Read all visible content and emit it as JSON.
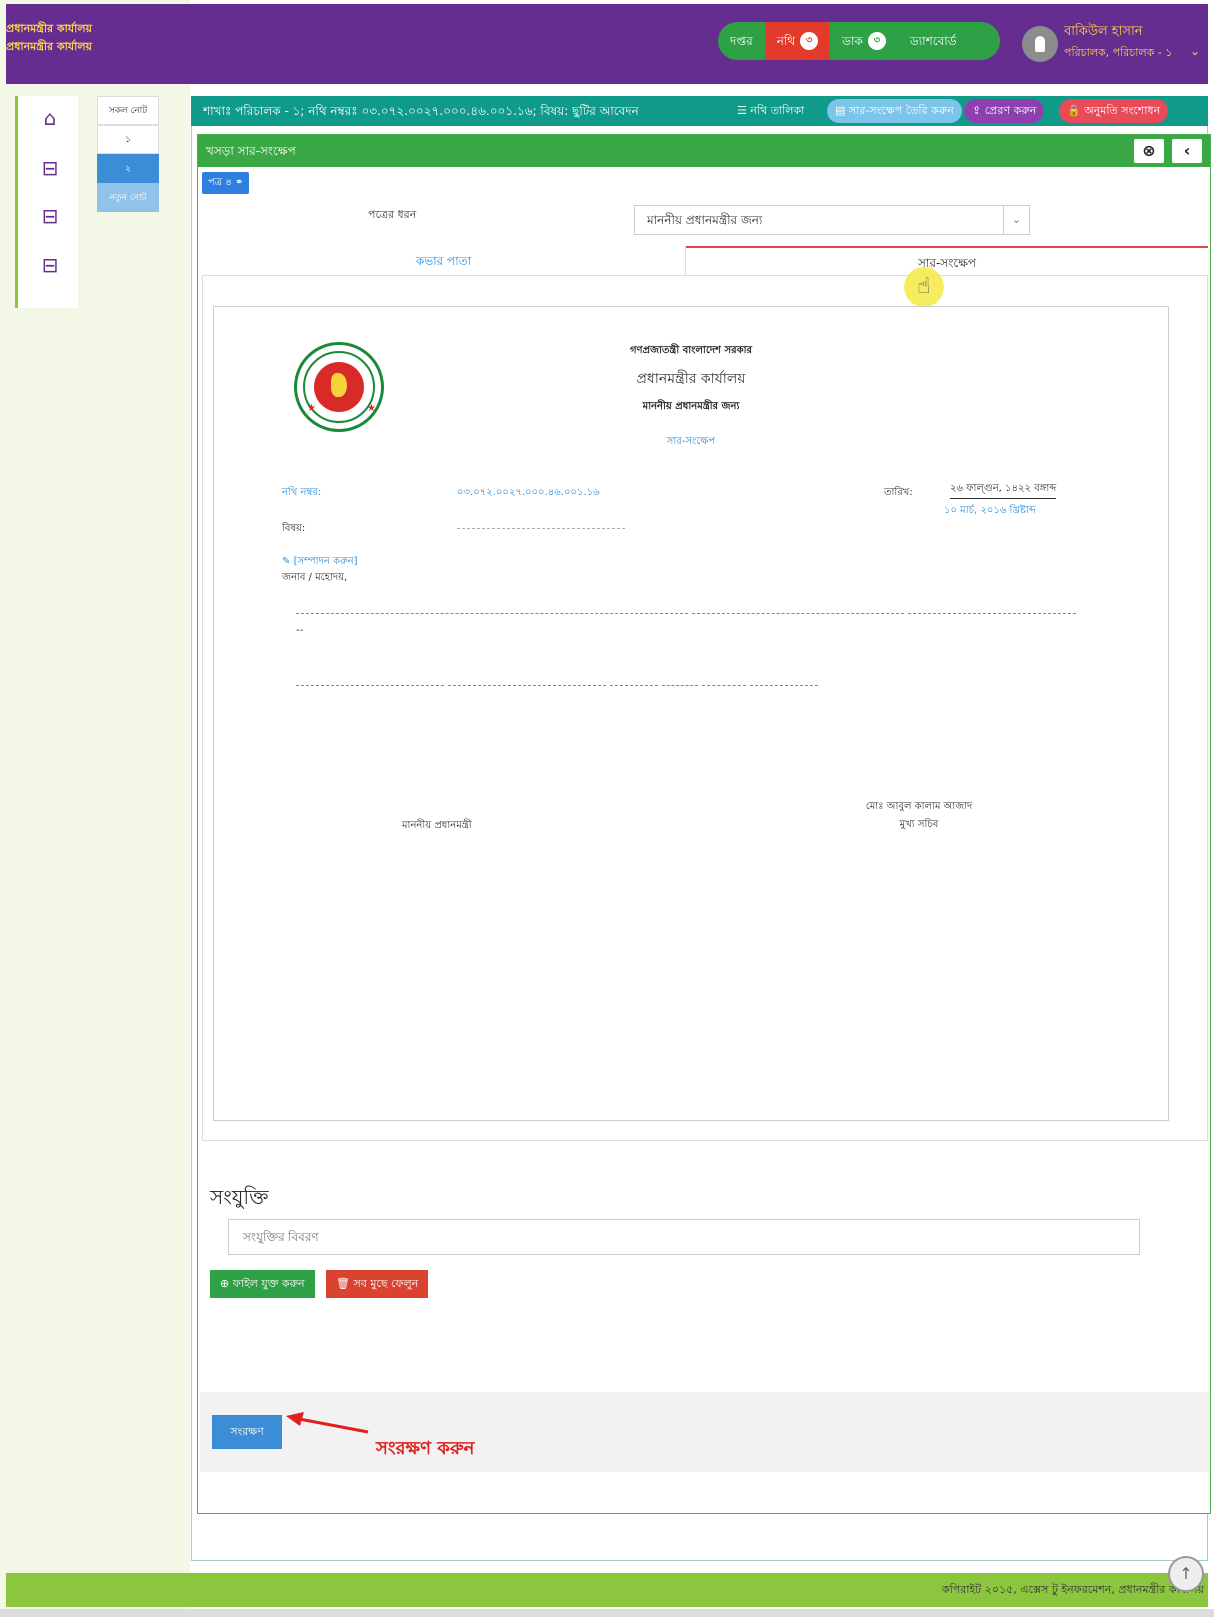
{
  "header": {
    "org_line1": "প্রধানমন্ত্রীর কার্যালয়",
    "org_line2": "প্রধানমন্ত্রীর কার্যালয়",
    "nav": {
      "office": "দপ্তর",
      "nothi": "নথি",
      "nothi_count": "৩",
      "dak": "ডাক",
      "dak_count": "৩",
      "dashboard": "ড্যাশবোর্ড"
    },
    "user_name": "বাকিউল হাসান",
    "user_role": "পরিচালক, পরিচালক - ১"
  },
  "notes": {
    "all_label": "সকল নোট",
    "items": [
      "১",
      "২"
    ],
    "new_label": "নতুন নোট"
  },
  "topbar": {
    "breadcrumb": "শাখাঃ পরিচালক - ১; নথি নম্বরঃ ০৩.০৭২.০০২৭.০০০.৪৬.০০১.১৬; বিষয়: ছুটির আবেদন",
    "nothi_list": "নথি তালিকা",
    "create_summary": "সার-সংক্ষেপ তৈরি করুন",
    "send": "প্রেরণ করুন",
    "permission": "অনুমতি সংশোধন"
  },
  "panel": {
    "title": "খসড়া সার-সংক্ষেপ",
    "tag": "পত্র ৪",
    "letter_type_label": "পত্রের ধরন",
    "letter_type_value": "মাননীয় প্রধানমন্ত্রীর জন্য",
    "tab_cover": "কভার পাতা",
    "tab_summary": "সার-সংক্ষেপ"
  },
  "doc": {
    "gov": "গণপ্রজাতন্ত্রী বাংলাদেশ সরকার",
    "office": "প্রধানমন্ত্রীর কার্যালয়",
    "for": "মাননীয় প্রধানমন্ত্রীর জন্য",
    "summary": "সার-সংক্ষেপ",
    "nothi_label": "নথি নম্বর:",
    "nothi_value": "০৩.০৭২.০০২৭.০০০.৪৬.০০১.১৬",
    "date_label": "তারিখ:",
    "date_bn": "২৬ ফাল্গুন, ১৪২২ বঙ্গাব্দ",
    "date_en": "১০ মার্চ, ২০১৬ খ্রিষ্টাব্দ",
    "subject_label": "বিষয়:",
    "edit_link": "[সম্পাদন করুন]",
    "salutation": "জনাব / মহোদয়,",
    "dashdash": "--",
    "pm": "মাননীয় প্রধানমন্ত্রী",
    "secretary_name": "মোঃ আবুল কালাম আজাদ",
    "secretary_title": "মুখ্য সচিব"
  },
  "attachments": {
    "heading": "সংযুক্তি",
    "placeholder": "সংযুক্তির বিবরণ",
    "add": "ফাইল যুক্ত করুন",
    "clear": "সব মুছে ফেলুন"
  },
  "save": {
    "label": "সংরক্ষণ",
    "callout": "সংরক্ষণ করুন"
  },
  "footer": {
    "copyright": "কপিরাইট ২০১৫, এক্সেস টু ইনফরমেশন, প্রধানমন্ত্রীর কার্যালয়"
  },
  "colors": {
    "header_bg": "#652d8f",
    "accent_green": "#3aa845",
    "accent_red": "#e23b2b",
    "accent_blue": "#3a8dd6"
  }
}
